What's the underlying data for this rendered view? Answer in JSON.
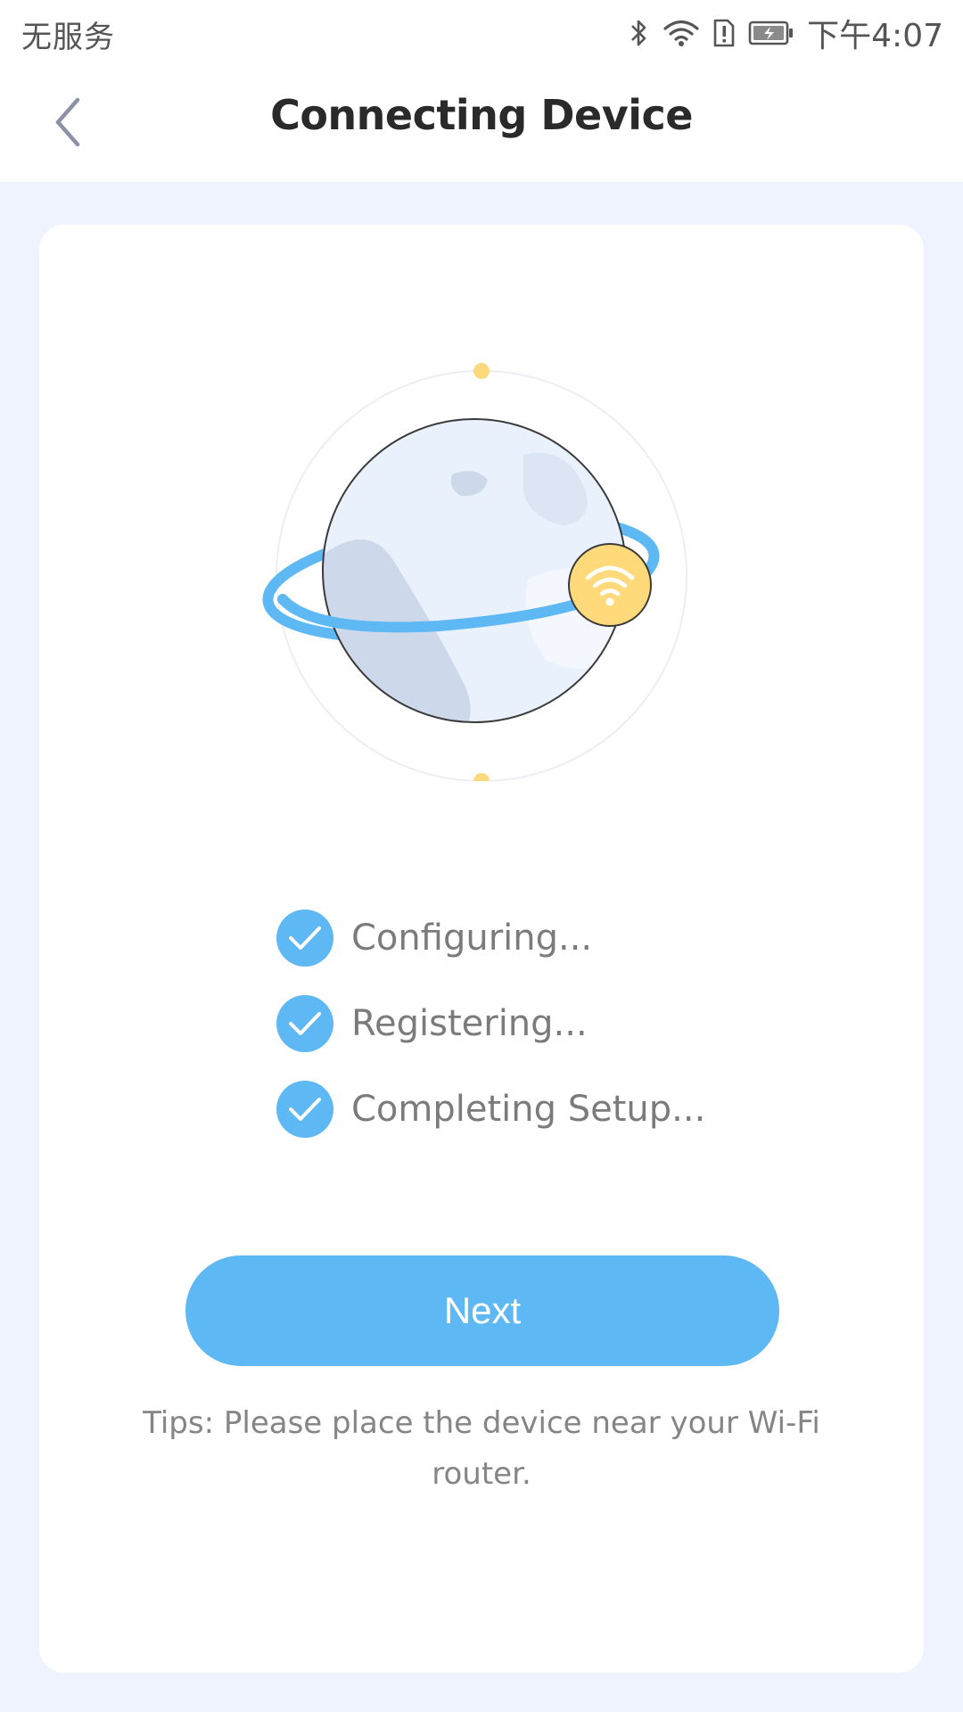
{
  "status_bar": {
    "carrier": "无服务",
    "time": "下午4:07",
    "icons": [
      "bluetooth-icon",
      "wifi-icon",
      "alert-icon",
      "battery-charging-icon"
    ]
  },
  "header": {
    "title": "Connecting Device",
    "back_icon": "chevron-left-icon"
  },
  "illustration": {
    "icons": [
      "globe-icon",
      "wifi-icon"
    ],
    "colors": {
      "ring": "#5eb8f4",
      "globe": "#e9f1fd",
      "land": "#cdd9ea",
      "badge": "#ffd97a"
    }
  },
  "steps": [
    {
      "label": "Configuring...",
      "status": "done",
      "icon": "check-icon"
    },
    {
      "label": "Registering...",
      "status": "done",
      "icon": "check-icon"
    },
    {
      "label": "Completing Setup...",
      "status": "done",
      "icon": "check-icon"
    }
  ],
  "next_button": {
    "label": "Next"
  },
  "tips": "Tips: Please place the device near your Wi-Fi router.",
  "colors": {
    "accent": "#5eb8f4",
    "page_background": "#eef3fd",
    "card": "#ffffff",
    "title_text": "#2a2a2a",
    "body_text": "#7b7b7b"
  }
}
